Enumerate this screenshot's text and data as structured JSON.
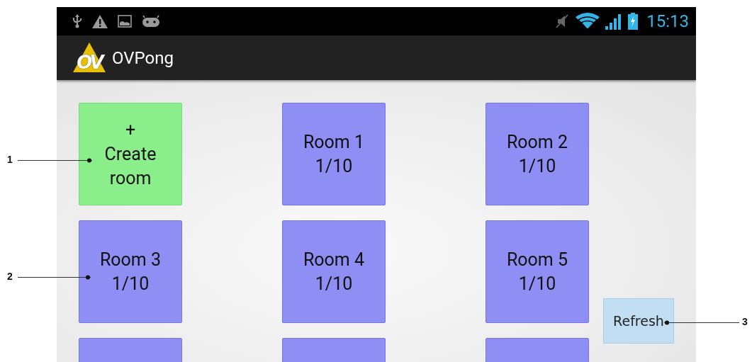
{
  "status_bar": {
    "time": "15:13"
  },
  "app_bar": {
    "logo_text": "OV",
    "title": "OVPong"
  },
  "tiles": [
    {
      "kind": "create",
      "icon": "+",
      "label": "Create room"
    },
    {
      "kind": "room",
      "name": "Room 1",
      "count": "1/10"
    },
    {
      "kind": "room",
      "name": "Room 2",
      "count": "1/10"
    },
    {
      "kind": "room",
      "name": "Room 3",
      "count": "1/10"
    },
    {
      "kind": "room",
      "name": "Room 4",
      "count": "1/10"
    },
    {
      "kind": "room",
      "name": "Room 5",
      "count": "1/10"
    },
    {
      "kind": "partial"
    },
    {
      "kind": "partial"
    },
    {
      "kind": "partial"
    }
  ],
  "refresh_button": {
    "label": "Refresh"
  },
  "callouts": [
    "1",
    "2",
    "3"
  ]
}
